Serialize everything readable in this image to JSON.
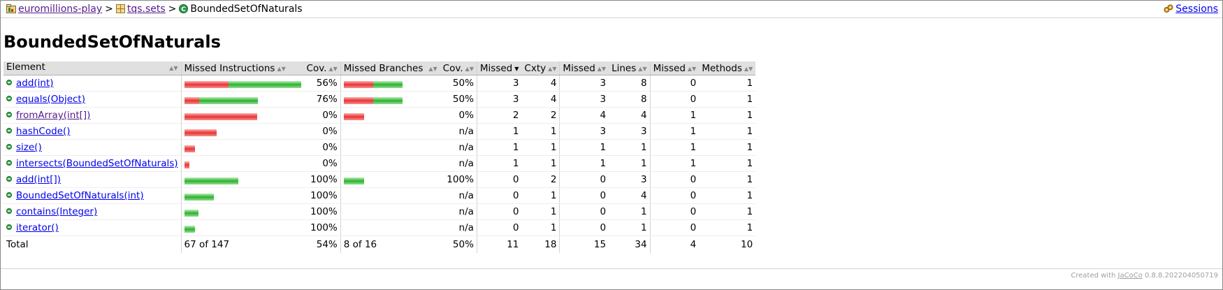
{
  "breadcrumb": {
    "project": "euromillions-play",
    "package": "tqs.sets",
    "class": "BoundedSetOfNaturals",
    "separator": ">",
    "sessions": "Sessions"
  },
  "page_title": "BoundedSetOfNaturals",
  "table": {
    "headers": {
      "element": "Element",
      "missed_instructions": "Missed Instructions",
      "cov1": "Cov.",
      "missed_branches": "Missed Branches",
      "cov2": "Cov.",
      "missed_cxty": "Missed",
      "cxty": "Cxty",
      "missed_lines": "Missed",
      "lines": "Lines",
      "missed_methods": "Missed",
      "methods": "Methods"
    },
    "rows": [
      {
        "element": "add(int)",
        "instr_missed": 3,
        "instr_covered": 5,
        "instr_cov": "56%",
        "br_missed": 2,
        "br_covered": 2,
        "br_cov": "50%",
        "missed_cxty": "3",
        "cxty": "4",
        "missed_lines": "3",
        "lines": "8",
        "missed_methods": "0",
        "methods": "1"
      },
      {
        "element": "equals(Object)",
        "instr_missed": 1,
        "instr_covered": 4,
        "instr_cov": "76%",
        "br_missed": 2,
        "br_covered": 2,
        "br_cov": "50%",
        "missed_cxty": "3",
        "cxty": "4",
        "missed_lines": "3",
        "lines": "8",
        "missed_methods": "0",
        "methods": "1"
      },
      {
        "element": "fromArray(int[])",
        "instr_missed": 5,
        "instr_covered": 0,
        "instr_cov": "0%",
        "br_missed": 1.4,
        "br_covered": 0,
        "br_cov": "0%",
        "missed_cxty": "2",
        "cxty": "2",
        "missed_lines": "4",
        "lines": "4",
        "missed_methods": "1",
        "methods": "1",
        "visited": true
      },
      {
        "element": "hashCode()",
        "instr_missed": 2.2,
        "instr_covered": 0,
        "instr_cov": "0%",
        "br_missed": 0,
        "br_covered": 0,
        "br_cov": "n/a",
        "missed_cxty": "1",
        "cxty": "1",
        "missed_lines": "3",
        "lines": "3",
        "missed_methods": "1",
        "methods": "1"
      },
      {
        "element": "size()",
        "instr_missed": 0.7,
        "instr_covered": 0,
        "instr_cov": "0%",
        "br_missed": 0,
        "br_covered": 0,
        "br_cov": "n/a",
        "missed_cxty": "1",
        "cxty": "1",
        "missed_lines": "1",
        "lines": "1",
        "missed_methods": "1",
        "methods": "1"
      },
      {
        "element": "intersects(BoundedSetOfNaturals)",
        "instr_missed": 0.35,
        "instr_covered": 0,
        "instr_cov": "0%",
        "br_missed": 0,
        "br_covered": 0,
        "br_cov": "n/a",
        "missed_cxty": "1",
        "cxty": "1",
        "missed_lines": "1",
        "lines": "1",
        "missed_methods": "1",
        "methods": "1"
      },
      {
        "element": "add(int[])",
        "instr_missed": 0,
        "instr_covered": 3.7,
        "instr_cov": "100%",
        "br_missed": 0,
        "br_covered": 1.4,
        "br_cov": "100%",
        "missed_cxty": "0",
        "cxty": "2",
        "missed_lines": "0",
        "lines": "3",
        "missed_methods": "0",
        "methods": "1"
      },
      {
        "element": "BoundedSetOfNaturals(int)",
        "instr_missed": 0,
        "instr_covered": 2.0,
        "instr_cov": "100%",
        "br_missed": 0,
        "br_covered": 0,
        "br_cov": "n/a",
        "missed_cxty": "0",
        "cxty": "1",
        "missed_lines": "0",
        "lines": "4",
        "missed_methods": "0",
        "methods": "1"
      },
      {
        "element": "contains(Integer)",
        "instr_missed": 0,
        "instr_covered": 0.95,
        "instr_cov": "100%",
        "br_missed": 0,
        "br_covered": 0,
        "br_cov": "n/a",
        "missed_cxty": "0",
        "cxty": "1",
        "missed_lines": "0",
        "lines": "1",
        "missed_methods": "0",
        "methods": "1"
      },
      {
        "element": "iterator()",
        "instr_missed": 0,
        "instr_covered": 0.7,
        "instr_cov": "100%",
        "br_missed": 0,
        "br_covered": 0,
        "br_cov": "n/a",
        "missed_cxty": "0",
        "cxty": "1",
        "missed_lines": "0",
        "lines": "1",
        "missed_methods": "0",
        "methods": "1"
      }
    ],
    "total": {
      "label": "Total",
      "instructions": "67 of 147",
      "instr_cov": "54%",
      "branches": "8 of 16",
      "br_cov": "50%",
      "missed_cxty": "11",
      "cxty": "18",
      "missed_lines": "15",
      "lines": "34",
      "missed_methods": "4",
      "methods": "10"
    }
  },
  "footer": {
    "prefix": "Created with",
    "link": "JaCoCo",
    "version": "0.8.8.202204050719"
  }
}
